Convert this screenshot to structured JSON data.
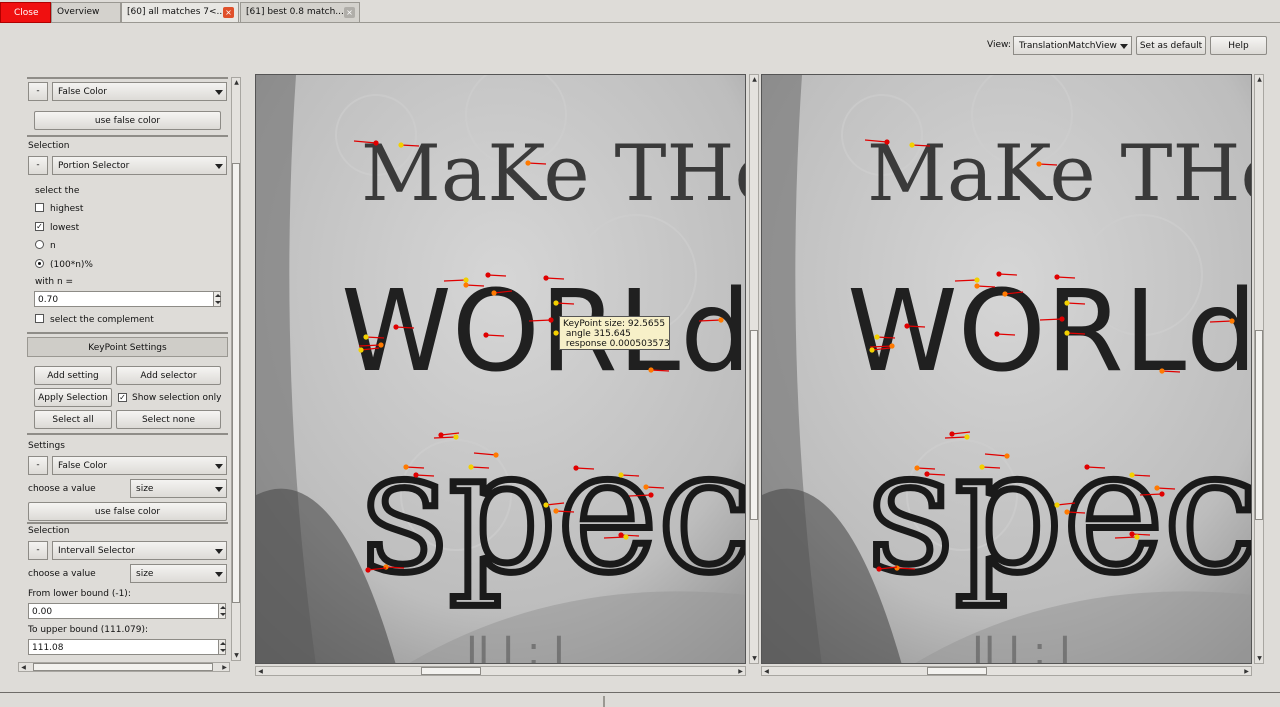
{
  "tabs": {
    "close_label": "Close",
    "overview_label": "Overview",
    "tab1_label": "[60] all matches 7<...",
    "tab2_label": "[61] best 0.8 match...",
    "close_icon_glyph": "×"
  },
  "header": {
    "view_label": "View:",
    "view_value": "TranslationMatchView",
    "set_default_label": "Set as default",
    "help_label": "Help"
  },
  "sidebar": {
    "false_color_1": {
      "minus": "-",
      "mode": "False Color",
      "use_label": "use false color"
    },
    "selection_1": {
      "heading": "Selection",
      "minus": "-",
      "selector": "Portion Selector",
      "select_the": "select the",
      "highest": "highest",
      "lowest": "lowest",
      "n": "n",
      "percent": "(100*n)%",
      "with_n": "with n =",
      "n_value": "0.70",
      "complement": "select the complement",
      "lowest_checked": "✓"
    },
    "keypoint_settings": {
      "title": "KeyPoint Settings",
      "add_setting": "Add setting",
      "add_selector": "Add selector",
      "apply_selection": "Apply Selection",
      "show_selection_only": "Show selection only",
      "show_checked": "✓",
      "select_all": "Select all",
      "select_none": "Select none"
    },
    "settings": {
      "heading": "Settings",
      "minus": "-",
      "mode": "False Color",
      "choose_value": "choose a value",
      "value": "size",
      "use_label": "use false color"
    },
    "selection_2": {
      "heading": "Selection",
      "minus": "-",
      "selector": "Intervall Selector",
      "choose_value": "choose a value",
      "value": "size",
      "lower_label": "From lower bound (-1):",
      "lower_value": "0.00",
      "upper_label": "To upper bound (111.079):",
      "upper_value": "111.08"
    }
  },
  "tooltip": {
    "text": "KeyPoint size: 92.5655\n angle 315.645\n response 0.000503573"
  },
  "images": {
    "left": {
      "line1": "MaKe THe",
      "line2": "WORLd",
      "line3": "spec"
    },
    "right": {
      "line1": "MaKe THe",
      "line2": "WORLd",
      "line3": "spec"
    }
  },
  "colors": {
    "close_red": "#f01010",
    "keypoint_red": "#e00000",
    "keypoint_yellow": "#f2d000",
    "keypoint_orange": "#ff7a00"
  }
}
